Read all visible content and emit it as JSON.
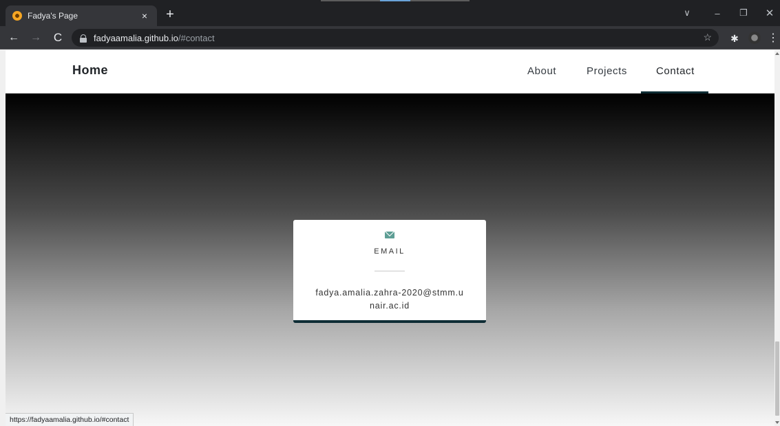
{
  "browser": {
    "tab_title": "Fadya's Page",
    "tab_close": "×",
    "new_tab": "+",
    "url_host": "fadyaamalia.github.io",
    "url_path": "/#contact",
    "status_url": "https://fadyaamalia.github.io/#contact",
    "icons": {
      "back": "←",
      "forward": "→",
      "reload": "C",
      "star": "☆",
      "extensions": "✱",
      "menu": "⋮",
      "chevron": "∨",
      "minimize": "–",
      "restore": "❐",
      "close": "✕"
    }
  },
  "navbar": {
    "brand": "Home",
    "links": [
      "About",
      "Projects",
      "Contact"
    ],
    "active": "Contact"
  },
  "contact_card": {
    "label": "EMAIL",
    "value": "fadya.amalia.zahra-2020@stmm.unair.ac.id"
  },
  "colors": {
    "accent": "#0f2d35",
    "icon": "#5e9e95"
  }
}
